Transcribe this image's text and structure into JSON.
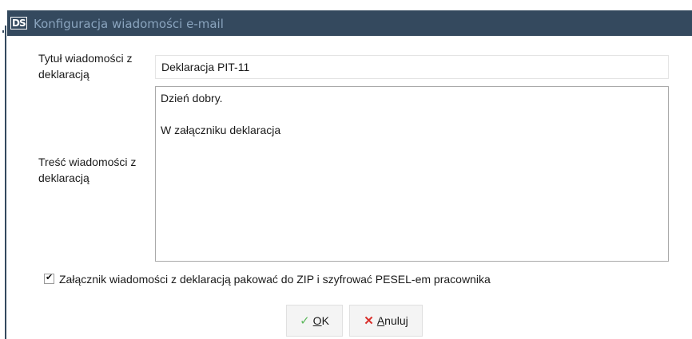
{
  "window": {
    "title": "Konfiguracja wiadomości e-mail",
    "logo_text": "DS"
  },
  "form": {
    "subject_label": "Tytuł wiadomości z deklaracją",
    "subject_value": "Deklaracja PIT-11",
    "body_label": "Treść wiadomości z deklaracją",
    "body_lines": [
      "Dzień dobry.",
      "",
      "W załączniku deklaracja"
    ],
    "zip_checkbox_label": "Załącznik wiadomości z deklaracją pakować do ZIP i szyfrować PESEL-em pracownika",
    "zip_checkbox_checked": true
  },
  "buttons": {
    "ok_mnemonic": "O",
    "ok_rest": "K",
    "cancel_mnemonic": "A",
    "cancel_rest": "nuluj"
  },
  "colors": {
    "titlebar": "#34495e",
    "ok_icon": "#5cb85c",
    "cancel_icon": "#d9302c"
  },
  "icons": {
    "ok": "checkmark-icon",
    "cancel": "x-icon",
    "app": "ds-logo-icon"
  }
}
